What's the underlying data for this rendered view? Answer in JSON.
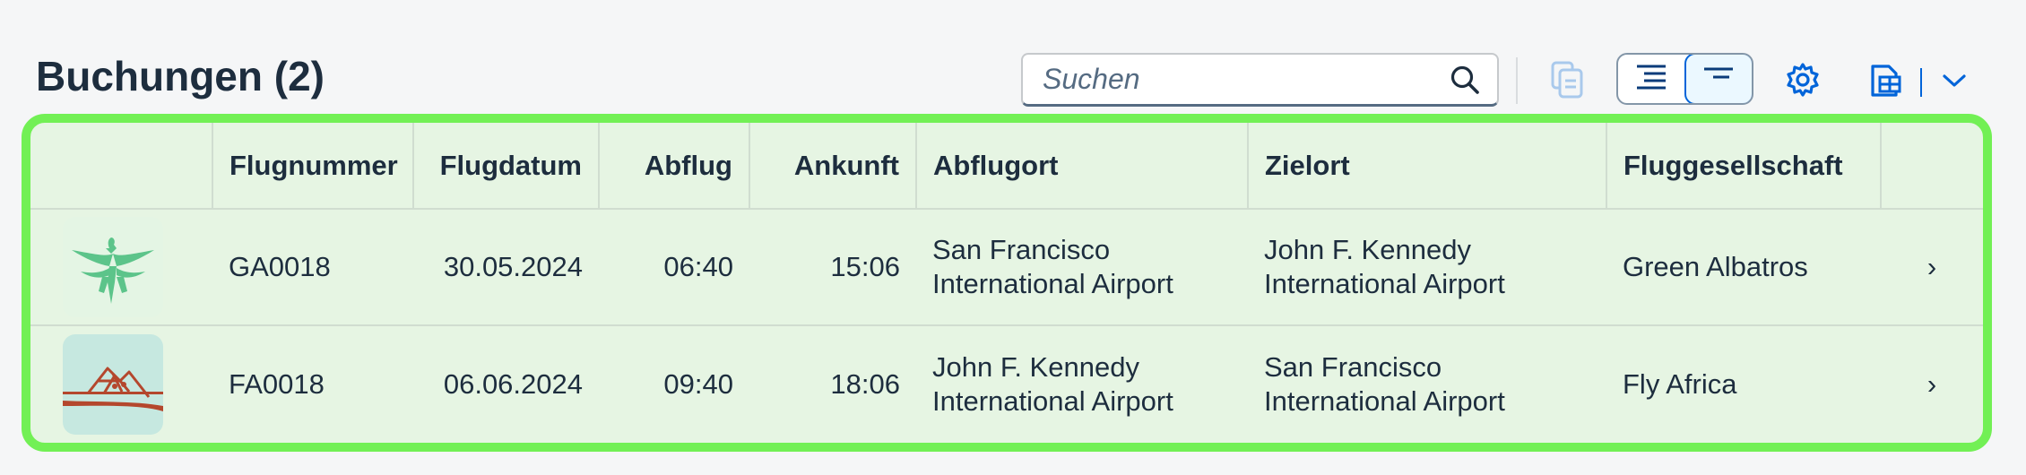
{
  "header": {
    "title": "Buchungen (2)",
    "search_placeholder": "Suchen"
  },
  "toolbar": {
    "icons": [
      "search-icon",
      "copy-icon",
      "list-view-icon",
      "compact-view-icon",
      "settings-icon",
      "export-icon",
      "chevron-down-icon"
    ]
  },
  "colors": {
    "highlight_border": "#72f055",
    "row_background": "#e6f5e3",
    "accent": "#0064d9",
    "albatros_logo": "#5cc48a",
    "africa_logo": "#b4472d"
  },
  "table": {
    "columns": [
      "",
      "Flugnummer",
      "Flugdatum",
      "Abflug",
      "Ankunft",
      "Abflugort",
      "Zielort",
      "Fluggesellschaft",
      ""
    ],
    "rows": [
      {
        "logo": "green-albatros-logo",
        "flugnummer": "GA0018",
        "flugdatum": "30.05.2024",
        "abflug": "06:40",
        "ankunft": "15:06",
        "abflugort_1": "San Francisco",
        "abflugort_2": "International Airport",
        "zielort_1": "John F. Kennedy",
        "zielort_2": "International Airport",
        "fluggesellschaft": "Green Albatros",
        "nav": "›"
      },
      {
        "logo": "fly-africa-logo",
        "flugnummer": "FA0018",
        "flugdatum": "06.06.2024",
        "abflug": "09:40",
        "ankunft": "18:06",
        "abflugort_1": "John F. Kennedy",
        "abflugort_2": "International Airport",
        "zielort_1": "San Francisco",
        "zielort_2": "International Airport",
        "fluggesellschaft": "Fly Africa",
        "nav": "›"
      }
    ]
  }
}
